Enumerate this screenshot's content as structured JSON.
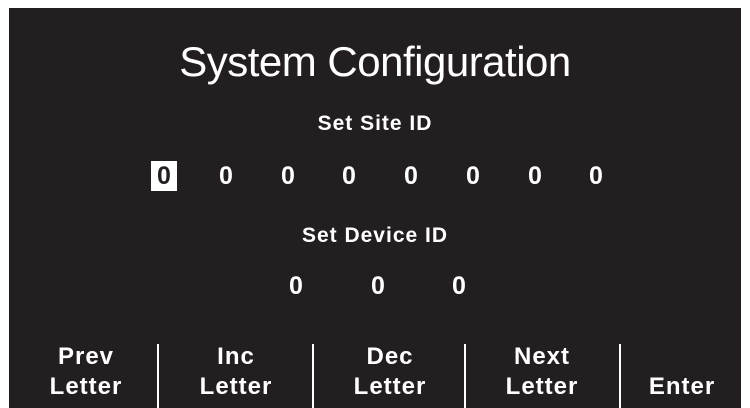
{
  "screen": {
    "title": "System Configuration",
    "site_id": {
      "label": "Set Site ID",
      "digits": [
        "0",
        "0",
        "0",
        "0",
        "0",
        "0",
        "0",
        "0"
      ],
      "selected_index": 0
    },
    "device_id": {
      "label": "Set Device ID",
      "digits": [
        "0",
        "0",
        "0"
      ]
    }
  },
  "softkeys": [
    {
      "line1": "Prev",
      "line2": "Letter"
    },
    {
      "line1": "Inc",
      "line2": "Letter"
    },
    {
      "line1": "Dec",
      "line2": "Letter"
    },
    {
      "line1": "Next",
      "line2": "Letter"
    },
    {
      "line1": "",
      "line2": "Enter"
    }
  ],
  "colors": {
    "background": "#231f20",
    "foreground": "#ffffff"
  }
}
